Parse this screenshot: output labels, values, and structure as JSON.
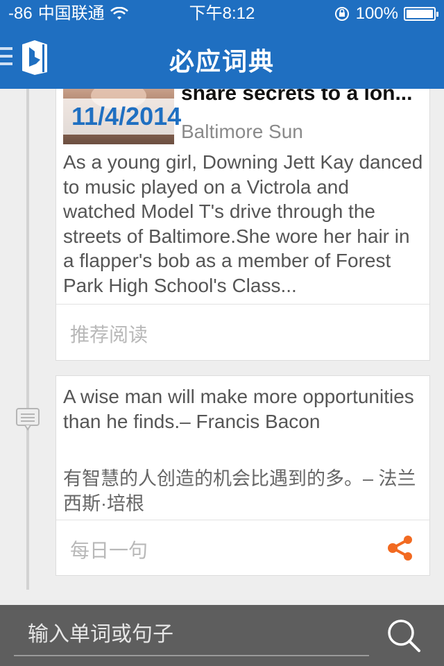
{
  "status_bar": {
    "signal": "-86",
    "carrier": "中国联通",
    "time": "下午8:12",
    "battery": "100%"
  },
  "app": {
    "title": "必应词典"
  },
  "news_card": {
    "date": "11/4/2014",
    "title": "share secrets to a lon...",
    "source": "Baltimore Sun",
    "summary": "As a young girl, Downing Jett Kay danced to music played on a Victrola and watched Model T's drive through the streets of Baltimore.She wore her hair in a flapper's bob as a member of Forest Park High School's Class...",
    "footer_label": "推荐阅读"
  },
  "daily_sentence_card": {
    "english": "A wise man will make more opportunities than he finds.– Francis Bacon",
    "chinese": "有智慧的人创造的机会比遇到的多。– 法兰西斯·培根",
    "footer_label": "每日一句"
  },
  "search": {
    "placeholder": "输入单词或句子"
  },
  "colors": {
    "brand_blue": "#1f6fc1",
    "share_orange": "#f26a21",
    "bottom_bar": "#5e5e5e"
  },
  "icons": {
    "menu": "menu-icon",
    "logo": "bing-logo",
    "timeline": "comment-icon",
    "share": "share-icon",
    "search": "search-icon"
  }
}
